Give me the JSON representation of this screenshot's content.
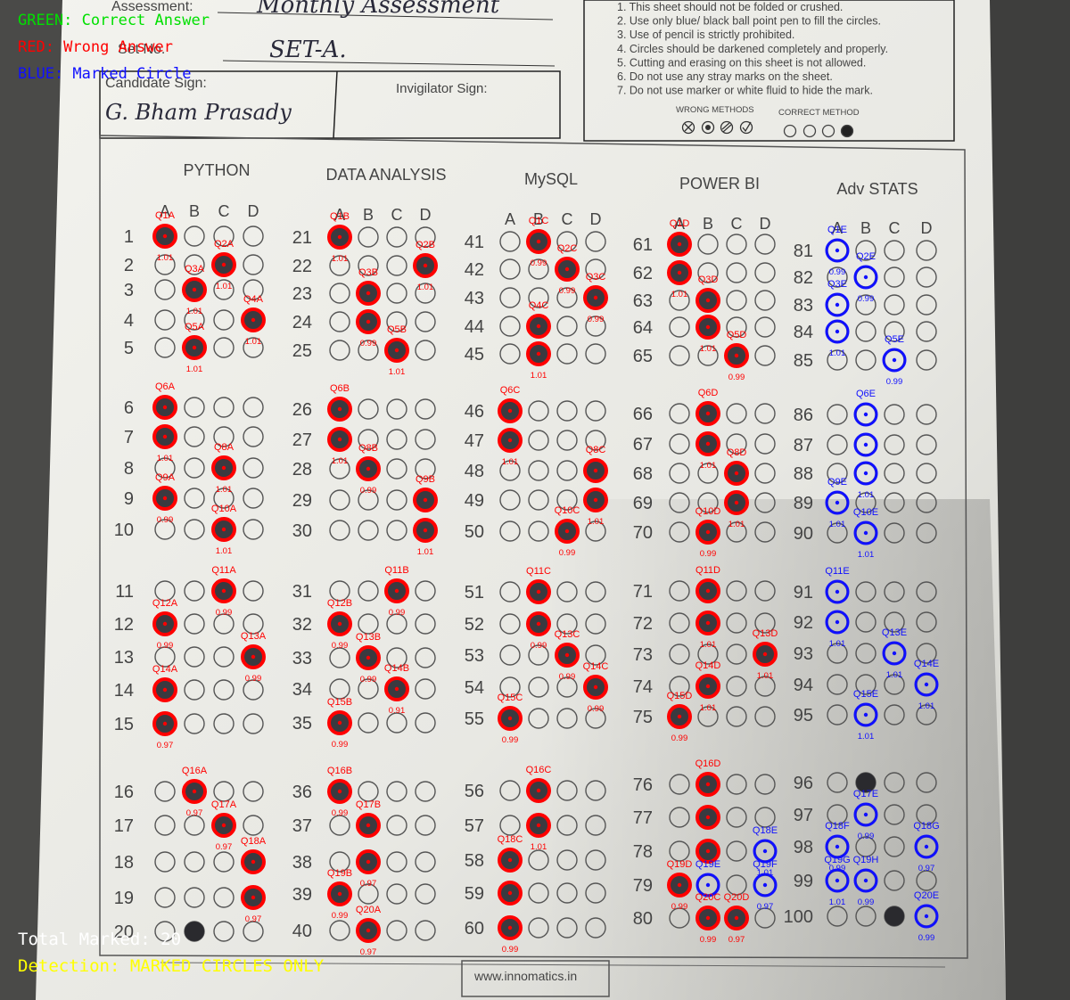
{
  "overlay": {
    "legend_green": "GREEN: Correct Answer",
    "legend_red": "RED: Wrong Answer",
    "legend_blue": "BLUE: Marked Circle",
    "total_marked": "Total Marked: 20",
    "detection_mode": "Detection: MARKED CIRCLES ONLY",
    "colors": {
      "green": "#00e000",
      "red": "#ff0000",
      "blue": "#1010ff",
      "yellow": "#ffff00"
    }
  },
  "sheet": {
    "header": {
      "assessment_label": "Assessment:",
      "assessment_value": "Monthly Assessment",
      "set_label": "Set No.",
      "set_value": "SET-A.",
      "candidate_sign_label": "Candidate Sign:",
      "candidate_signature": "G. Bham Prasady",
      "invigilator_sign_label": "Invigilator Sign:"
    },
    "instructions": [
      "1.  This sheet should not be folded or crushed.",
      "2.  Use only blue/ black ball point pen to fill the circles.",
      "3.  Use of pencil is strictly prohibited.",
      "4.  Circles should be darkened completely and properly.",
      "5.  Cutting and erasing on this sheet is not allowed.",
      "6.  Do not use any stray marks on the sheet.",
      "7.  Do not use marker or white fluid to hide the mark."
    ],
    "wrong_methods_label": "WRONG METHODS",
    "correct_method_label": "CORRECT METHOD",
    "footer_url": "www.innomatics.in",
    "options": [
      "A",
      "B",
      "C",
      "D"
    ],
    "subjects": [
      {
        "name": "PYTHON",
        "first_q": 1
      },
      {
        "name": "DATA ANALYSIS",
        "first_q": 21
      },
      {
        "name": "MySQL",
        "first_q": 41
      },
      {
        "name": "POWER BI",
        "first_q": 61
      },
      {
        "name": "Adv STATS",
        "first_q": 81
      }
    ]
  },
  "detections": {
    "PYTHON": [
      {
        "q": 1,
        "opt": "A",
        "label": "Q1A",
        "score": "1.01",
        "color": "red"
      },
      {
        "q": 2,
        "opt": "C",
        "label": "Q2A",
        "score": "1.01",
        "color": "red"
      },
      {
        "q": 3,
        "opt": "B",
        "label": "Q3A",
        "score": "1.01",
        "color": "red"
      },
      {
        "q": 4,
        "opt": "D",
        "label": "Q4A",
        "score": "1.01",
        "color": "red"
      },
      {
        "q": 5,
        "opt": "B",
        "label": "Q5A",
        "score": "1.01",
        "color": "red"
      },
      {
        "q": 6,
        "opt": "A",
        "label": "Q6A",
        "score": "",
        "color": "red"
      },
      {
        "q": 7,
        "opt": "A",
        "label": "",
        "score": "1.01",
        "color": "red"
      },
      {
        "q": 8,
        "opt": "C",
        "label": "Q8A",
        "score": "1.01",
        "color": "red"
      },
      {
        "q": 9,
        "opt": "A",
        "label": "Q9A",
        "score": "0.99",
        "color": "red"
      },
      {
        "q": 10,
        "opt": "C",
        "label": "Q10A",
        "score": "1.01",
        "color": "red"
      },
      {
        "q": 11,
        "opt": "C",
        "label": "Q11A",
        "score": "0.99",
        "color": "red"
      },
      {
        "q": 12,
        "opt": "A",
        "label": "Q12A",
        "score": "0.99",
        "color": "red"
      },
      {
        "q": 13,
        "opt": "D",
        "label": "Q13A",
        "score": "0.99",
        "color": "red"
      },
      {
        "q": 14,
        "opt": "A",
        "label": "Q14A",
        "score": "",
        "color": "red"
      },
      {
        "q": 15,
        "opt": "A",
        "label": "",
        "score": "0.97",
        "color": "red"
      },
      {
        "q": 16,
        "opt": "B",
        "label": "Q16A",
        "score": "0.97",
        "color": "red"
      },
      {
        "q": 17,
        "opt": "C",
        "label": "Q17A",
        "score": "0.97",
        "color": "red"
      },
      {
        "q": 18,
        "opt": "D",
        "label": "Q18A",
        "score": "",
        "color": "red"
      },
      {
        "q": 19,
        "opt": "D",
        "label": "",
        "score": "0.97",
        "color": "red"
      }
    ],
    "DATA ANALYSIS": [
      {
        "q": 21,
        "opt": "A",
        "label": "Q1B",
        "score": "1.01",
        "color": "red"
      },
      {
        "q": 22,
        "opt": "D",
        "label": "Q2B",
        "score": "1.01",
        "color": "red"
      },
      {
        "q": 23,
        "opt": "B",
        "label": "Q3B",
        "score": "",
        "color": "red"
      },
      {
        "q": 24,
        "opt": "B",
        "label": "",
        "score": "0.99",
        "color": "red"
      },
      {
        "q": 25,
        "opt": "C",
        "label": "Q5B",
        "score": "1.01",
        "color": "red"
      },
      {
        "q": 26,
        "opt": "A",
        "label": "Q6B",
        "score": "",
        "color": "red"
      },
      {
        "q": 27,
        "opt": "A",
        "label": "",
        "score": "1.01",
        "color": "red"
      },
      {
        "q": 28,
        "opt": "B",
        "label": "Q8B",
        "score": "0.99",
        "color": "red"
      },
      {
        "q": 29,
        "opt": "D",
        "label": "Q9B",
        "score": "",
        "color": "red"
      },
      {
        "q": 30,
        "opt": "D",
        "label": "",
        "score": "1.01",
        "color": "red"
      },
      {
        "q": 31,
        "opt": "C",
        "label": "Q11B",
        "score": "0.99",
        "color": "red"
      },
      {
        "q": 32,
        "opt": "A",
        "label": "Q12B",
        "score": "0.99",
        "color": "red"
      },
      {
        "q": 33,
        "opt": "B",
        "label": "Q13B",
        "score": "0.99",
        "color": "red"
      },
      {
        "q": 34,
        "opt": "C",
        "label": "Q14B",
        "score": "0.91",
        "color": "red"
      },
      {
        "q": 35,
        "opt": "A",
        "label": "Q15B",
        "score": "0.99",
        "color": "red"
      },
      {
        "q": 36,
        "opt": "A",
        "label": "Q16B",
        "score": "0.99",
        "color": "red"
      },
      {
        "q": 37,
        "opt": "B",
        "label": "Q17B",
        "score": "",
        "color": "red"
      },
      {
        "q": 38,
        "opt": "B",
        "label": "",
        "score": "0.97",
        "color": "red"
      },
      {
        "q": 39,
        "opt": "A",
        "label": "Q19B",
        "score": "0.99",
        "color": "red"
      },
      {
        "q": 40,
        "opt": "B",
        "label": "Q20A",
        "score": "0.97",
        "color": "red"
      }
    ],
    "MySQL": [
      {
        "q": 41,
        "opt": "B",
        "label": "Q1C",
        "score": "0.99",
        "color": "red"
      },
      {
        "q": 42,
        "opt": "C",
        "label": "Q2C",
        "score": "0.99",
        "color": "red"
      },
      {
        "q": 43,
        "opt": "D",
        "label": "Q3C",
        "score": "0.99",
        "color": "red"
      },
      {
        "q": 44,
        "opt": "B",
        "label": "Q4C",
        "score": "",
        "color": "red"
      },
      {
        "q": 45,
        "opt": "B",
        "label": "",
        "score": "1.01",
        "color": "red"
      },
      {
        "q": 46,
        "opt": "A",
        "label": "Q6C",
        "score": "",
        "color": "red"
      },
      {
        "q": 47,
        "opt": "A",
        "label": "",
        "score": "1.01",
        "color": "red"
      },
      {
        "q": 48,
        "opt": "D",
        "label": "Q8C",
        "score": "",
        "color": "red"
      },
      {
        "q": 49,
        "opt": "D",
        "label": "",
        "score": "1.01",
        "color": "red"
      },
      {
        "q": 50,
        "opt": "C",
        "label": "Q10C",
        "score": "0.99",
        "color": "red"
      },
      {
        "q": 51,
        "opt": "B",
        "label": "Q11C",
        "score": "",
        "color": "red"
      },
      {
        "q": 52,
        "opt": "B",
        "label": "",
        "score": "0.99",
        "color": "red"
      },
      {
        "q": 53,
        "opt": "C",
        "label": "Q13C",
        "score": "0.99",
        "color": "red"
      },
      {
        "q": 54,
        "opt": "D",
        "label": "Q14C",
        "score": "0.99",
        "color": "red"
      },
      {
        "q": 55,
        "opt": "A",
        "label": "Q15C",
        "score": "0.99",
        "color": "red"
      },
      {
        "q": 56,
        "opt": "B",
        "label": "Q16C",
        "score": "",
        "color": "red"
      },
      {
        "q": 57,
        "opt": "B",
        "label": "",
        "score": "1.01",
        "color": "red"
      },
      {
        "q": 58,
        "opt": "A",
        "label": "Q18C",
        "score": "",
        "color": "red"
      },
      {
        "q": 59,
        "opt": "A",
        "label": "",
        "score": "",
        "color": "red"
      },
      {
        "q": 60,
        "opt": "A",
        "label": "",
        "score": "0.99",
        "color": "red"
      }
    ],
    "POWER BI": [
      {
        "q": 61,
        "opt": "A",
        "label": "Q1D",
        "score": "",
        "color": "red"
      },
      {
        "q": 62,
        "opt": "A",
        "label": "",
        "score": "1.01",
        "color": "red"
      },
      {
        "q": 63,
        "opt": "B",
        "label": "Q3D",
        "score": "",
        "color": "red"
      },
      {
        "q": 64,
        "opt": "B",
        "label": "",
        "score": "1.01",
        "color": "red"
      },
      {
        "q": 65,
        "opt": "C",
        "label": "Q5D",
        "score": "0.99",
        "color": "red"
      },
      {
        "q": 66,
        "opt": "B",
        "label": "Q6D",
        "score": "",
        "color": "red"
      },
      {
        "q": 67,
        "opt": "B",
        "label": "",
        "score": "1.01",
        "color": "red"
      },
      {
        "q": 68,
        "opt": "C",
        "label": "Q8D",
        "score": "",
        "color": "red"
      },
      {
        "q": 69,
        "opt": "C",
        "label": "",
        "score": "1.01",
        "color": "red"
      },
      {
        "q": 70,
        "opt": "B",
        "label": "Q10D",
        "score": "0.99",
        "color": "red"
      },
      {
        "q": 71,
        "opt": "B",
        "label": "Q11D",
        "score": "",
        "color": "red"
      },
      {
        "q": 72,
        "opt": "B",
        "label": "",
        "score": "1.01",
        "color": "red"
      },
      {
        "q": 73,
        "opt": "D",
        "label": "Q13D",
        "score": "1.01",
        "color": "red"
      },
      {
        "q": 74,
        "opt": "B",
        "label": "Q14D",
        "score": "1.01",
        "color": "red"
      },
      {
        "q": 75,
        "opt": "A",
        "label": "Q15D",
        "score": "0.99",
        "color": "red"
      },
      {
        "q": 76,
        "opt": "B",
        "label": "Q16D",
        "score": "",
        "color": "red"
      },
      {
        "q": 77,
        "opt": "B",
        "label": "",
        "score": "",
        "color": "red"
      },
      {
        "q": 78,
        "opt": "B",
        "label": "",
        "score": "",
        "color": "red"
      },
      {
        "q": 78,
        "opt": "D",
        "label": "Q18E",
        "score": "1.01",
        "color": "blue"
      },
      {
        "q": 79,
        "opt": "A",
        "label": "Q19D",
        "score": "0.99",
        "color": "red"
      },
      {
        "q": 79,
        "opt": "B",
        "label": "Q19E",
        "score": "",
        "color": "blue"
      },
      {
        "q": 79,
        "opt": "D",
        "label": "Q19F",
        "score": "0.97",
        "color": "blue"
      },
      {
        "q": 80,
        "opt": "B",
        "label": "Q20C",
        "score": "0.99",
        "color": "red"
      },
      {
        "q": 80,
        "opt": "C",
        "label": "Q20D",
        "score": "0.97",
        "color": "red"
      }
    ],
    "Adv STATS": [
      {
        "q": 81,
        "opt": "A",
        "label": "Q1E",
        "score": "0.99",
        "color": "blue"
      },
      {
        "q": 82,
        "opt": "B",
        "label": "Q2E",
        "score": "0.99",
        "color": "blue"
      },
      {
        "q": 83,
        "opt": "A",
        "label": "Q3E",
        "score": "",
        "color": "blue"
      },
      {
        "q": 84,
        "opt": "A",
        "label": "",
        "score": "1.01",
        "color": "blue"
      },
      {
        "q": 85,
        "opt": "C",
        "label": "Q5E",
        "score": "0.99",
        "color": "blue"
      },
      {
        "q": 86,
        "opt": "B",
        "label": "Q6E",
        "score": "",
        "color": "blue"
      },
      {
        "q": 87,
        "opt": "B",
        "label": "",
        "score": "",
        "color": "blue"
      },
      {
        "q": 88,
        "opt": "B",
        "label": "",
        "score": "1.01",
        "color": "blue"
      },
      {
        "q": 89,
        "opt": "A",
        "label": "Q9E",
        "score": "1.01",
        "color": "blue"
      },
      {
        "q": 90,
        "opt": "B",
        "label": "Q10E",
        "score": "1.01",
        "color": "blue"
      },
      {
        "q": 91,
        "opt": "A",
        "label": "Q11E",
        "score": "",
        "color": "blue"
      },
      {
        "q": 92,
        "opt": "A",
        "label": "",
        "score": "1.01",
        "color": "blue"
      },
      {
        "q": 93,
        "opt": "C",
        "label": "Q13E",
        "score": "1.01",
        "color": "blue"
      },
      {
        "q": 94,
        "opt": "D",
        "label": "Q14E",
        "score": "1.01",
        "color": "blue"
      },
      {
        "q": 95,
        "opt": "B",
        "label": "Q15E",
        "score": "1.01",
        "color": "blue"
      },
      {
        "q": 97,
        "opt": "B",
        "label": "Q17E",
        "score": "0.99",
        "color": "blue"
      },
      {
        "q": 98,
        "opt": "A",
        "label": "Q18F",
        "score": "0.99",
        "color": "blue"
      },
      {
        "q": 98,
        "opt": "D",
        "label": "Q18G",
        "score": "0.97",
        "color": "blue"
      },
      {
        "q": 99,
        "opt": "A",
        "label": "Q19G",
        "score": "1.01",
        "color": "blue"
      },
      {
        "q": 99,
        "opt": "B",
        "label": "Q19H",
        "score": "0.99",
        "color": "blue"
      },
      {
        "q": 100,
        "opt": "D",
        "label": "Q20E",
        "score": "0.99",
        "color": "blue"
      }
    ]
  },
  "pen_marks_undetected": [
    {
      "q": 20,
      "opt": "B"
    },
    {
      "q": 96,
      "opt": "B"
    },
    {
      "q": 100,
      "opt": "C"
    }
  ]
}
